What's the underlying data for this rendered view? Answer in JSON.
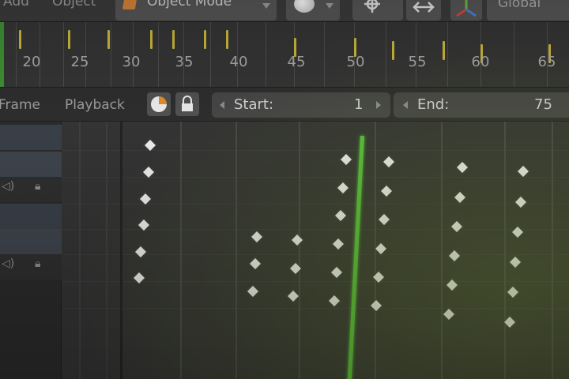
{
  "header": {
    "menu_add": "Add",
    "menu_object": "Object",
    "mode_label": "Object Mode",
    "orientation_label": "Global",
    "icons": [
      "object-cube-icon",
      "sphere-shading-icon",
      "pivot-icon",
      "transform-arrows-icon",
      "gizmo-axis-icon"
    ]
  },
  "ruler": {
    "frame_labels": [
      "20",
      "25",
      "30",
      "35",
      "40",
      "45",
      "50",
      "55",
      "60",
      "65"
    ]
  },
  "playback_bar": {
    "frame_menu": "Frame",
    "playback_menu": "Playback",
    "start_label": "Start:",
    "start_value": "1",
    "end_label": "End:",
    "end_value": "75",
    "icons": [
      "keying-set-icon",
      "lock-icon"
    ]
  },
  "channels": {
    "icons": [
      "speaker-icon",
      "lock-icon"
    ]
  },
  "colors": {
    "playhead": "#56c03b",
    "keyframe": "#eeeeee",
    "ruler_key": "#c9b53a",
    "background": "#343434"
  }
}
